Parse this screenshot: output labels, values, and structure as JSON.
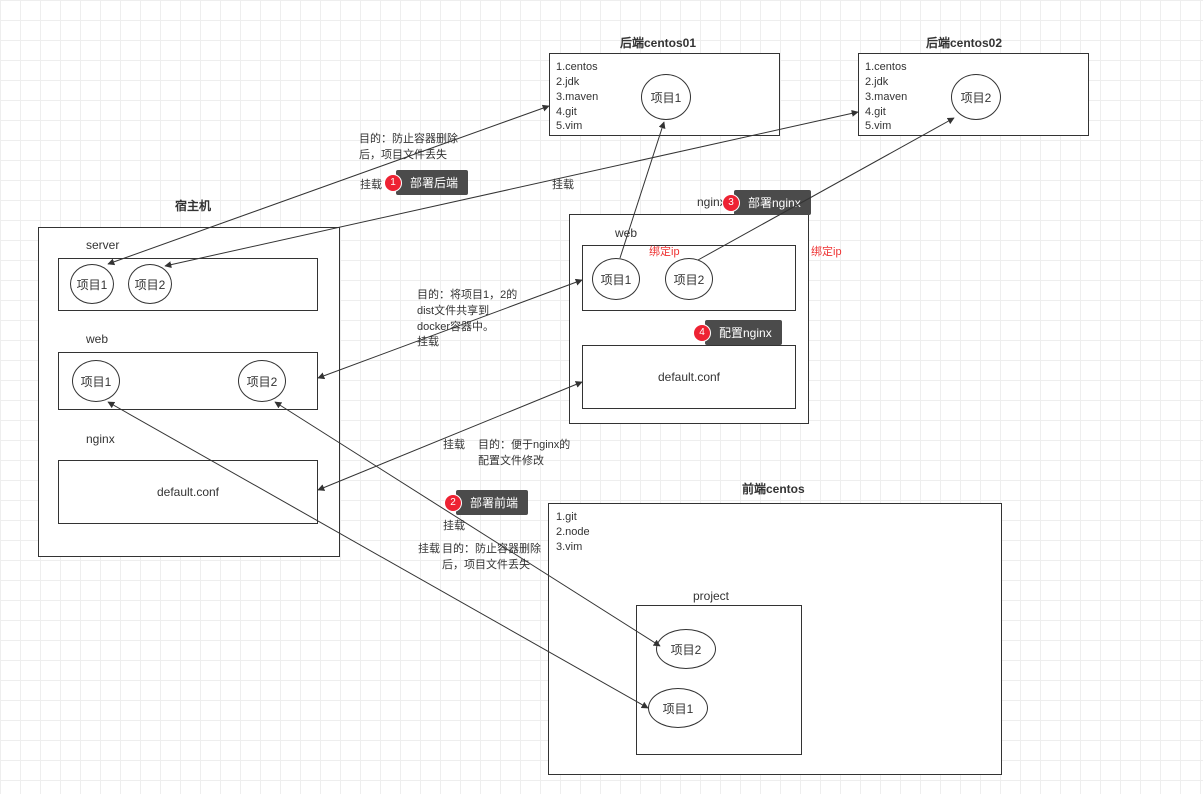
{
  "boxes": {
    "host": {
      "title": "宿主机"
    },
    "host_server": {
      "title": "server"
    },
    "host_web": {
      "title": "web"
    },
    "host_nginx": {
      "title": "nginx"
    },
    "host_defaultconf": "default.conf",
    "backend1": {
      "title": "后端centos01",
      "list": "1.centos\n2.jdk\n3.maven\n4.git\n5.vim"
    },
    "backend2": {
      "title": "后端centos02",
      "list": "1.centos\n2.jdk\n3.maven\n4.git\n5.vim"
    },
    "nginxbox": {
      "title": "nginx"
    },
    "nginx_web": {
      "title": "web"
    },
    "nginx_defaultconf": "default.conf",
    "frontend": {
      "title": "前端centos",
      "list": "1.git\n2.node\n3.vim"
    },
    "frontend_project": {
      "title": "project"
    }
  },
  "circles": {
    "host_srv_p1": "项目1",
    "host_srv_p2": "项目2",
    "host_web_p1": "项目1",
    "host_web_p2": "项目2",
    "be1_p1": "项目1",
    "be2_p2": "项目2",
    "ngx_p1": "项目1",
    "ngx_p2": "项目2",
    "fe_p1": "项目1",
    "fe_p2": "项目2"
  },
  "labels": {
    "note_be": "目的：防止容器删除\n后，项目文件丢失",
    "mount1": "挂载",
    "mount2": "挂载",
    "mount3": "挂载",
    "mount4": "挂载",
    "mount5": "挂载",
    "mount6": "挂载",
    "note_dist": "目的：将项目1，2的\ndist文件共享到\ndocker容器中。",
    "note_conf": "目的：便于nginx的\n配置文件修改",
    "note_fe": "目的：防止容器删除\n后，项目文件丢失",
    "bindip1": "绑定ip",
    "bindip2": "绑定ip"
  },
  "callouts": {
    "c1": {
      "num": "1",
      "text": "部署后端"
    },
    "c2": {
      "num": "2",
      "text": "部署前端"
    },
    "c3": {
      "num": "3",
      "text": "部署nginx"
    },
    "c4": {
      "num": "4",
      "text": "配置nginx"
    }
  }
}
